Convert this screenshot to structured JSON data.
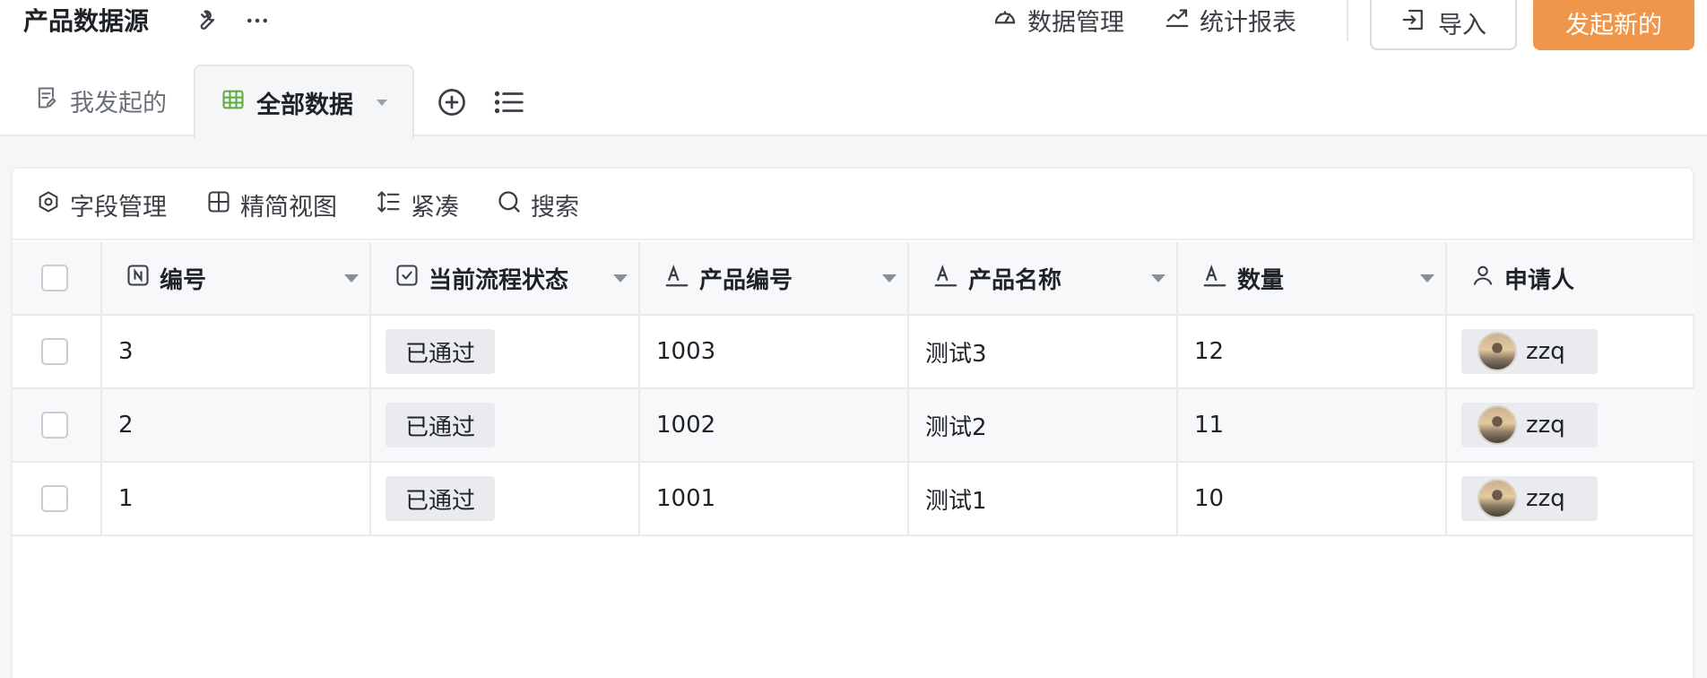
{
  "app": {
    "title": "产品数据源",
    "title_icons": [
      "wrench-icon",
      "more-icon"
    ]
  },
  "top_actions": {
    "data_manage": "数据管理",
    "stats_report": "统计报表",
    "import": "导入",
    "new": "发起新的"
  },
  "tabs": {
    "mine": "我发起的",
    "all": "全部数据"
  },
  "toolbar": {
    "fields": "字段管理",
    "simple_view": "精简视图",
    "compact": "紧凑",
    "search": "搜索"
  },
  "table": {
    "columns": [
      "编号",
      "当前流程状态",
      "产品编号",
      "产品名称",
      "数量",
      "申请人"
    ],
    "rows": [
      {
        "no": "3",
        "status": "已通过",
        "code": "1003",
        "name": "测试3",
        "qty": "12",
        "user": "zzq"
      },
      {
        "no": "2",
        "status": "已通过",
        "code": "1002",
        "name": "测试2",
        "qty": "11",
        "user": "zzq"
      },
      {
        "no": "1",
        "status": "已通过",
        "code": "1001",
        "name": "测试1",
        "qty": "10",
        "user": "zzq"
      }
    ]
  },
  "colors": {
    "primary": "#f0964b",
    "table_icon": "#5fae3f"
  }
}
